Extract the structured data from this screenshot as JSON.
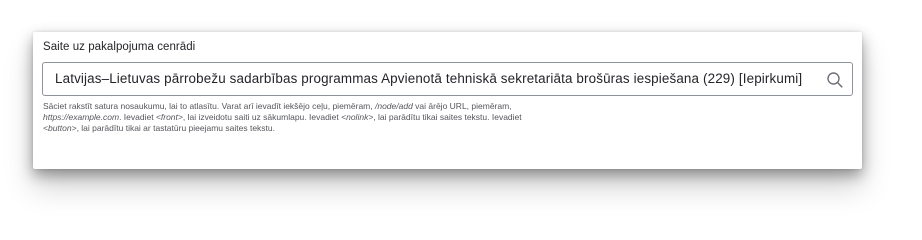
{
  "field": {
    "label": "Saite uz pakalpojuma cenrādi",
    "value": "Latvijas–Lietuvas pārrobežu sadarbības programmas Apvienotā tehniskā sekretariāta brošūras iespiešana (229) [Iepirkumi]",
    "search_icon": "search-icon"
  },
  "description": {
    "part1": "Sāciet rakstīt satura nosaukumu, lai to atlasītu. Varat arī ievadīt iekšējo ceļu, piemēram, ",
    "node_add": "/node/add",
    "part2": " vai ārējo URL, piemēram, ",
    "example_url": "https://example.com",
    "part3": ". Ievadiet ",
    "front": "<front>",
    "part4": ", lai izveidotu saiti uz sākumlapu. Ievadiet ",
    "nolink": "<nolink>",
    "part5": ", lai parādītu tikai saites tekstu. Ievadiet ",
    "button": "<button>",
    "part6": ", lai parādītu tikai ar tastatūru pieejamu saites tekstu."
  }
}
